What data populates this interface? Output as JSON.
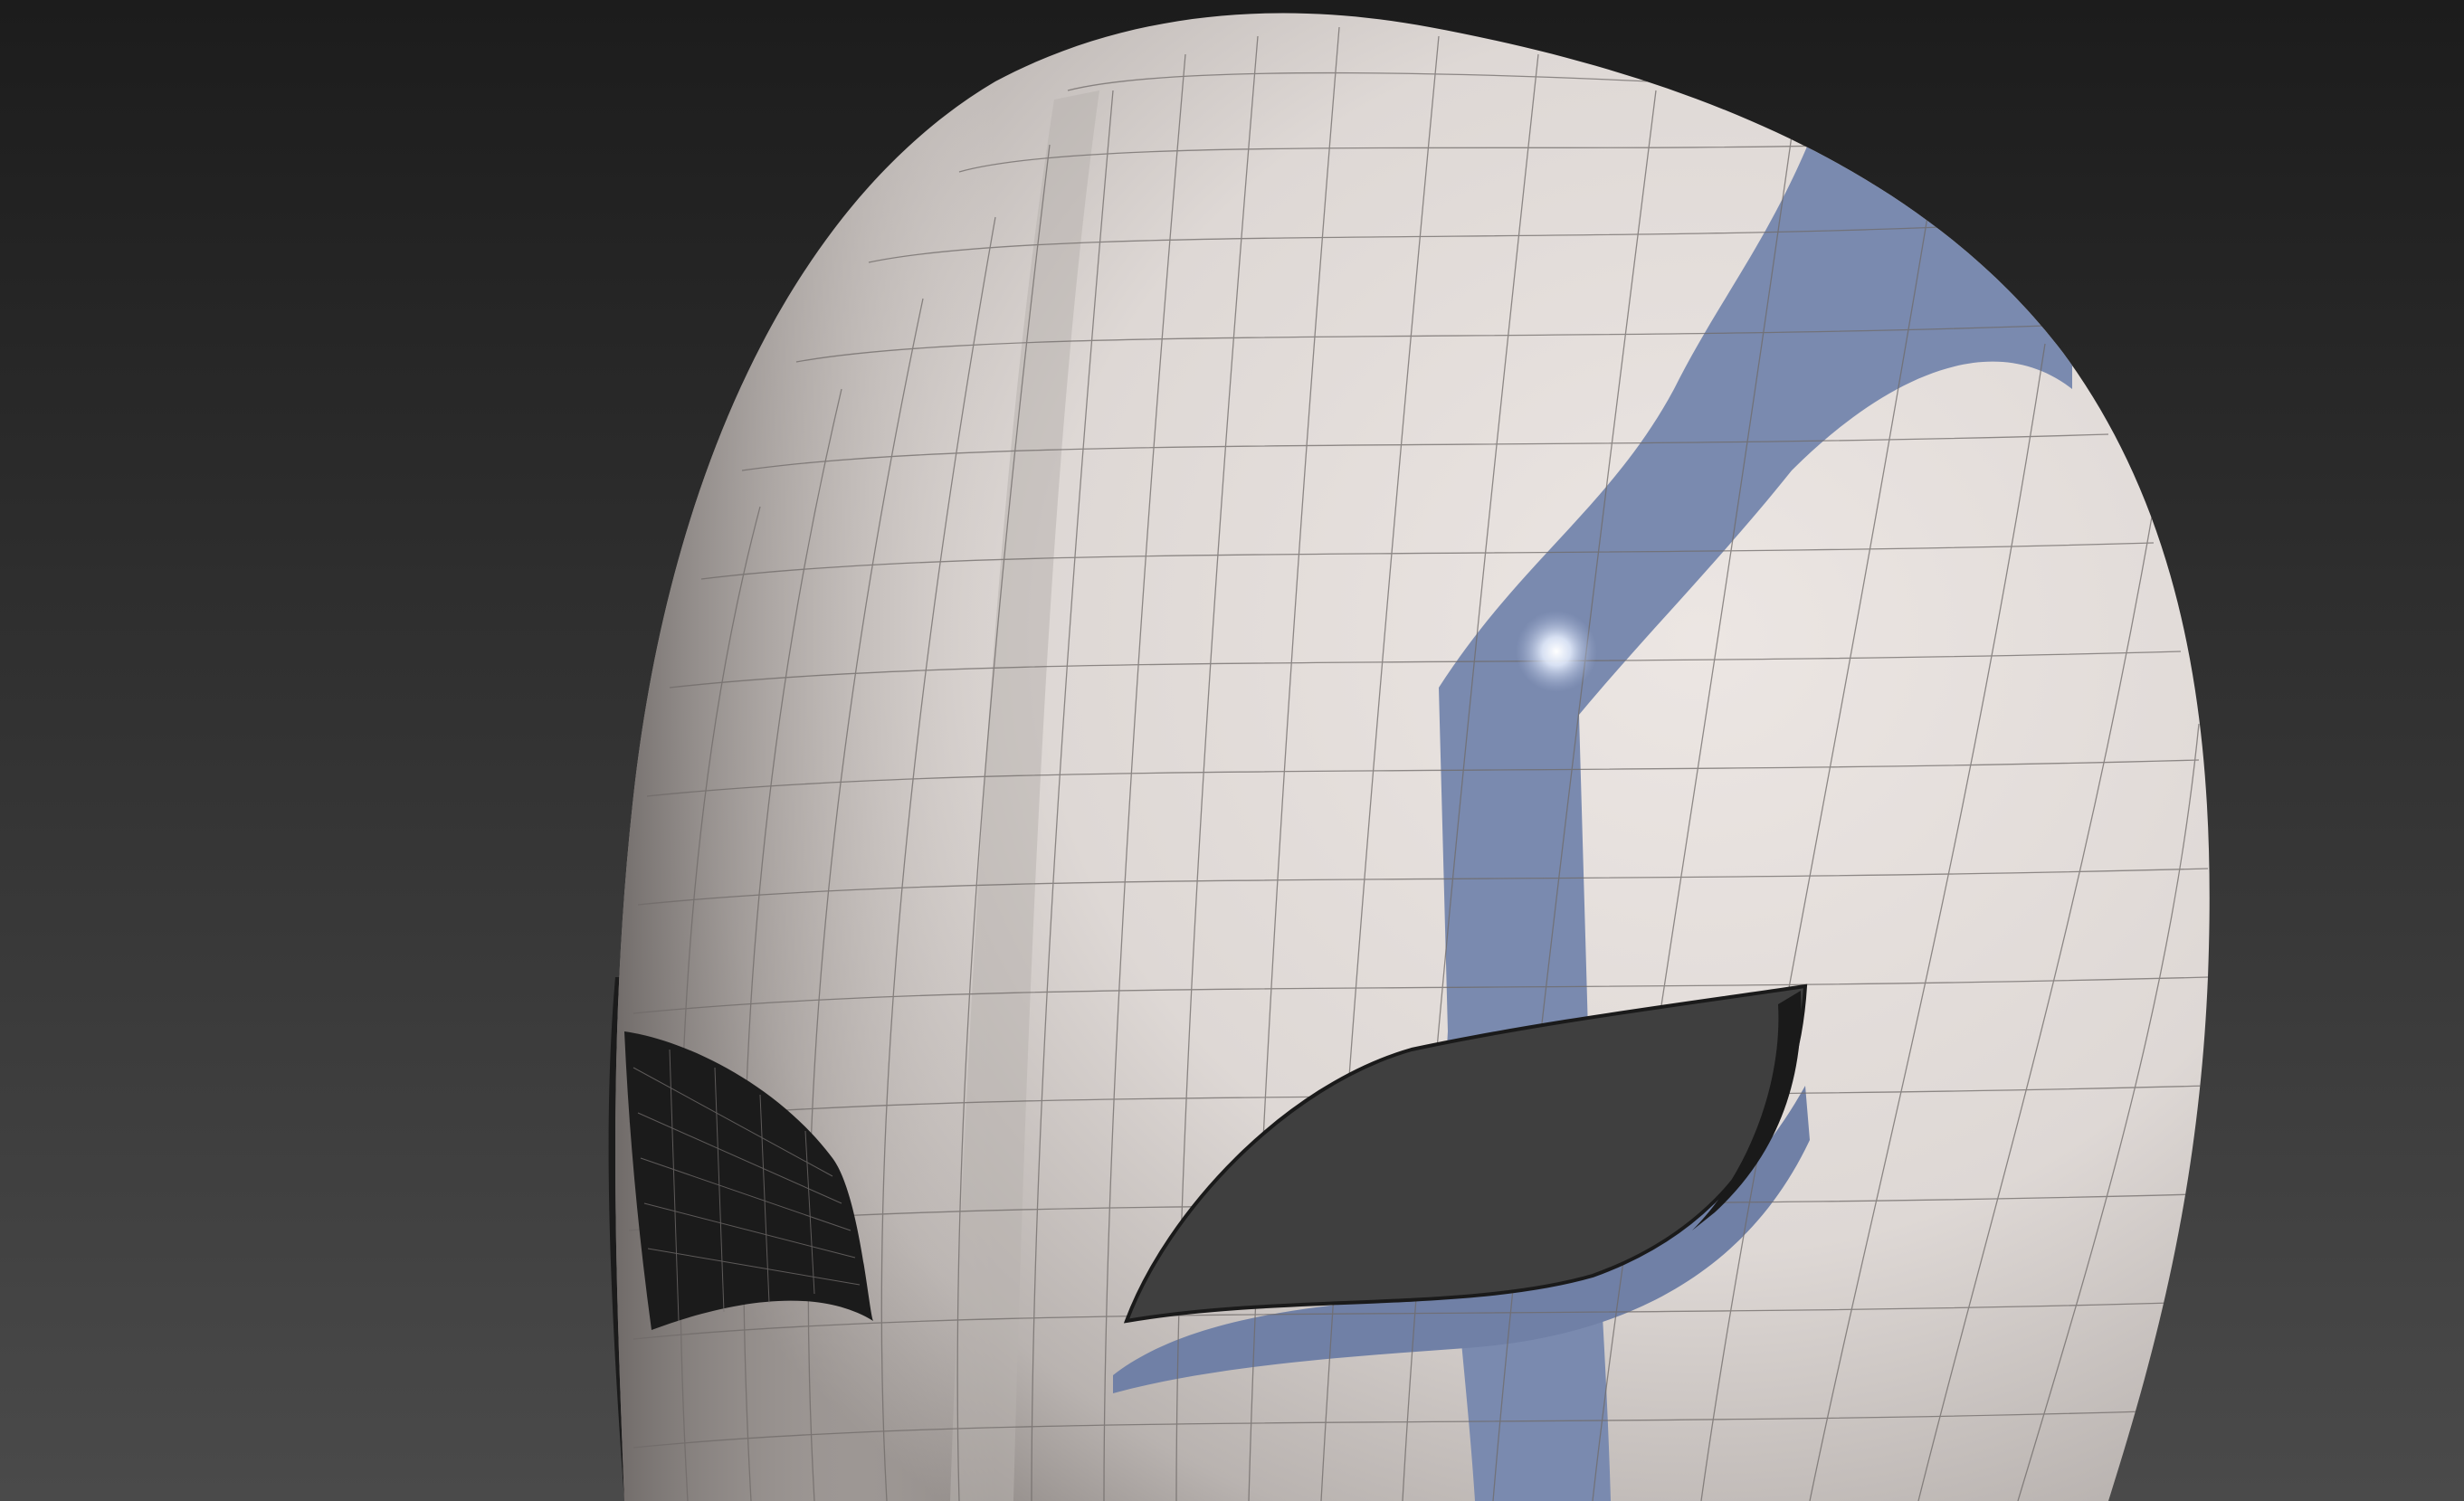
{
  "viewport": {
    "type": "3d-viewport",
    "background_top": "#1c1c1c",
    "background_bottom": "#4a4a4a"
  },
  "scene": {
    "object": "mask-model",
    "shading": "shaded-with-wireframe",
    "colors": {
      "mask_surface": "#e8e2df",
      "mask_shadow": "#9b9592",
      "wire_lines": "#6f6a68",
      "stripe": "#7a8aaf",
      "stripe_dark": "#6d7ca0",
      "specular": "#ffffff",
      "eye_hole": "#3f3f3f",
      "inner_shell": "#1b1b1b"
    }
  }
}
